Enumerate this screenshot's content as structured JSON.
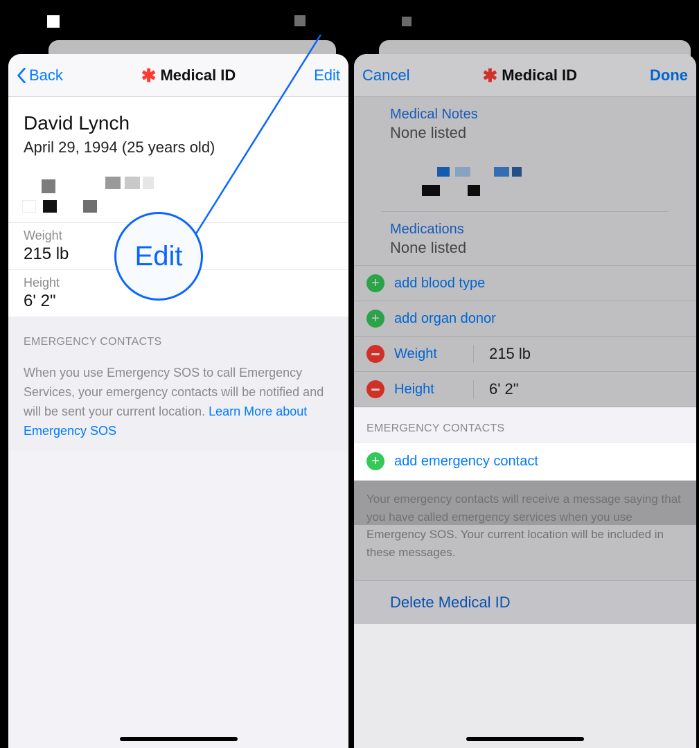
{
  "left": {
    "nav": {
      "back": "Back",
      "title": "Medical ID",
      "edit": "Edit"
    },
    "person": {
      "name": "David Lynch",
      "dob": "April 29, 1994 (25 years old)"
    },
    "weight": {
      "label": "Weight",
      "value": "215 lb"
    },
    "height": {
      "label": "Height",
      "value": "6' 2\""
    },
    "ec_header": "EMERGENCY CONTACTS",
    "sos_text": "When you use Emergency SOS to call Emergency Services, your emergency contacts will be notified and will be sent your current location. ",
    "sos_link": "Learn More about Emergency SOS",
    "callout": "Edit"
  },
  "right": {
    "nav": {
      "cancel": "Cancel",
      "title": "Medical ID",
      "done": "Done"
    },
    "notes": {
      "label": "Medical Notes",
      "value": "None listed"
    },
    "meds": {
      "label": "Medications",
      "value": "None listed"
    },
    "add_blood": "add blood type",
    "add_organ": "add organ donor",
    "weight": {
      "label": "Weight",
      "value": "215 lb"
    },
    "height": {
      "label": "Height",
      "value": "6' 2\""
    },
    "ec_header": "EMERGENCY CONTACTS",
    "add_ec": "add emergency contact",
    "ec_desc": "Your emergency contacts will receive a message saying that you have called emergency services when you use Emergency SOS. Your current location will be included in these messages.",
    "delete": "Delete Medical ID"
  }
}
